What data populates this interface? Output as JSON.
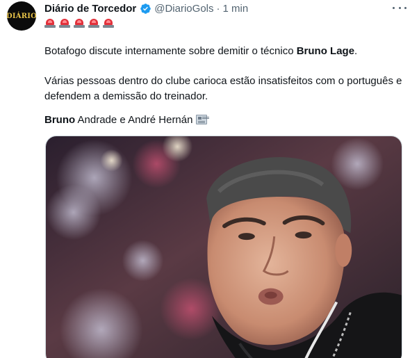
{
  "author": {
    "avatar_text": "DIÁRIO",
    "name": "Diário de Torcedor",
    "handle": "@DiarioGols",
    "separator": "·",
    "time": "1 min"
  },
  "icons": {
    "verified": "verified-badge-icon",
    "more": "more-options-icon",
    "siren": "police-car-light-icon",
    "newspaper": "newspaper-icon"
  },
  "colors": {
    "verified_blue": "#1d9bf0",
    "text": "#0f1419",
    "secondary_text": "#536471"
  },
  "sirens": [
    "🚨",
    "🚨",
    "🚨",
    "🚨",
    "🚨"
  ],
  "text": {
    "p1_plain": "Botafogo discute internamente sobre demitir o técnico ",
    "p1_bold": "Bruno Lage",
    "p1_end": ".",
    "p2": "Várias pessoas dentro do clube carioca estão insatisfeitos com o português e defendem a demissão do treinador.",
    "p3_bold": "Bruno",
    "p3_plain": " Andrade e André Hernán"
  },
  "media": {
    "type": "photo",
    "subject": "man-portrait"
  }
}
